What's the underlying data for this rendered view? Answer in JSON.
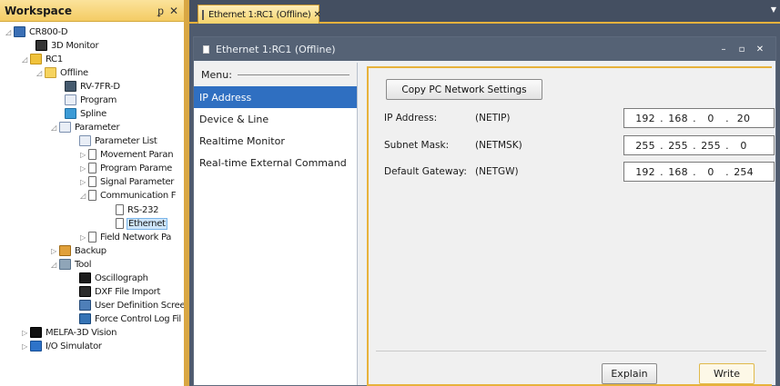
{
  "workspace": {
    "title": "Workspace",
    "pin": "ᵱ",
    "close": "✕",
    "tree": [
      {
        "label": "CR800-D",
        "expander": "◿",
        "icon": "pc-icon"
      },
      {
        "label": "3D Monitor",
        "expander": "",
        "icon": "3d-monitor-icon"
      },
      {
        "label": "RC1",
        "expander": "◿",
        "icon": "robot-controller-icon"
      },
      {
        "label": "Offline",
        "expander": "◿",
        "icon": "offline-icon"
      },
      {
        "label": "RV-7FR-D",
        "expander": "",
        "icon": "robot-icon"
      },
      {
        "label": "Program",
        "expander": "",
        "icon": "program-icon"
      },
      {
        "label": "Spline",
        "expander": "",
        "icon": "spline-icon"
      },
      {
        "label": "Parameter",
        "expander": "◿",
        "icon": "parameter-icon"
      },
      {
        "label": "Parameter List",
        "expander": "",
        "icon": "parameter-list-icon"
      },
      {
        "label": "Movement Paran",
        "expander": "▷",
        "icon": "file-icon"
      },
      {
        "label": "Program Parame",
        "expander": "▷",
        "icon": "file-icon"
      },
      {
        "label": "Signal Parameter",
        "expander": "▷",
        "icon": "file-icon"
      },
      {
        "label": "Communication F",
        "expander": "◿",
        "icon": "file-icon"
      },
      {
        "label": "RS-232",
        "expander": "",
        "icon": "file-icon"
      },
      {
        "label": "Ethernet",
        "expander": "",
        "icon": "file-icon",
        "selected": true
      },
      {
        "label": "Field Network Pa",
        "expander": "▷",
        "icon": "file-icon"
      },
      {
        "label": "Backup",
        "expander": "▷",
        "icon": "backup-icon"
      },
      {
        "label": "Tool",
        "expander": "◿",
        "icon": "tool-icon"
      },
      {
        "label": "Oscillograph",
        "expander": "",
        "icon": "oscillograph-icon"
      },
      {
        "label": "DXF File Import",
        "expander": "",
        "icon": "dxf-icon"
      },
      {
        "label": "User Definition Scree",
        "expander": "",
        "icon": "user-definition-icon"
      },
      {
        "label": "Force Control Log Fil",
        "expander": "",
        "icon": "force-control-icon"
      },
      {
        "label": "MELFA-3D Vision",
        "expander": "▷",
        "icon": "melfa-3d-icon"
      },
      {
        "label": "I/O Simulator",
        "expander": "▷",
        "icon": "io-simulator-icon"
      }
    ]
  },
  "tab": {
    "label": "Ethernet 1:RC1 (Offline)",
    "close": "✕"
  },
  "window": {
    "title": "Ethernet 1:RC1 (Offline)",
    "minimize": "–",
    "restore": "▫",
    "close": "✕"
  },
  "menu": {
    "header": "Menu:",
    "items": [
      "IP Address",
      "Device & Line",
      "Realtime Monitor",
      "Real-time External Command"
    ],
    "active_index": 0
  },
  "settings": {
    "copy_button": "Copy PC Network Settings",
    "fields": [
      {
        "label": "IP Address:",
        "var": "(NETIP)",
        "octets": [
          "192",
          "168",
          "0",
          "20"
        ]
      },
      {
        "label": "Subnet Mask:",
        "var": "(NETMSK)",
        "octets": [
          "255",
          "255",
          "255",
          "0"
        ]
      },
      {
        "label": "Default Gateway:",
        "var": "(NETGW)",
        "octets": [
          "192",
          "168",
          "0",
          "254"
        ]
      }
    ],
    "explain_button": "Explain",
    "write_button": "Write"
  },
  "colors": {
    "accent": "#e7b23c",
    "menu_active": "#2f6fc1",
    "title_bar": "#556275"
  }
}
